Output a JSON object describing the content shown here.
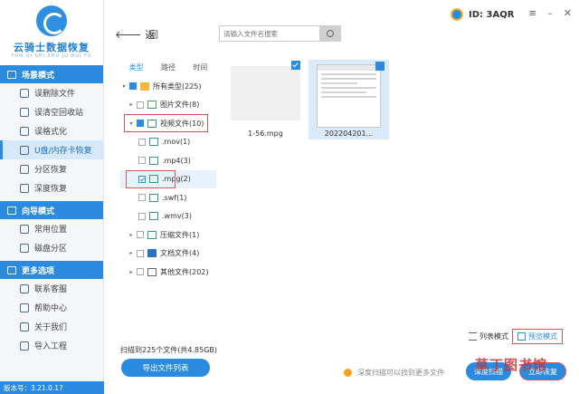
{
  "app": {
    "name": "云骑士数据恢复",
    "subtitle": "YUN QI SHI SHU JU HUI FU",
    "version": "版本号：3.21.0.17",
    "user_id": "ID: 3AQR"
  },
  "sidebar": {
    "sections": [
      {
        "title": "场景模式",
        "items": [
          "误删除文件",
          "误清空回收站",
          "误格式化",
          "U盘/内存卡恢复",
          "分区恢复",
          "深度恢复"
        ]
      },
      {
        "title": "向导模式",
        "items": [
          "常用位置",
          "磁盘分区"
        ]
      },
      {
        "title": "更多选项",
        "items": [
          "联系客服",
          "帮助中心",
          "关于我们",
          "导入工程"
        ]
      }
    ],
    "active_item": "U盘/内存卡恢复"
  },
  "toolbar": {
    "back_label": "返",
    "refresh_label": "回",
    "search_placeholder": "请输入文件名搜索"
  },
  "tree": {
    "tabs": [
      "类型",
      "路径",
      "时间"
    ],
    "rows": [
      {
        "label": "所有类型(225)"
      },
      {
        "label": "图片文件(8)"
      },
      {
        "label": "视频文件(10)"
      },
      {
        "label": ".mov(1)"
      },
      {
        "label": ".mp4(3)"
      },
      {
        "label": ".mpg(2)"
      },
      {
        "label": ".swf(1)"
      },
      {
        "label": ".wmv(3)"
      },
      {
        "label": "压缩文件(1)"
      },
      {
        "label": "文档文件(4)"
      },
      {
        "label": "其他文件(202)"
      }
    ]
  },
  "files": [
    {
      "name": "1-56.mpg"
    },
    {
      "name": "202204201..."
    }
  ],
  "view": {
    "list_label": "列表模式",
    "preview_label": "预览模式"
  },
  "footer": {
    "scan_info": "扫描到225个文件(共4.85GB)",
    "export_label": "导出文件列表",
    "hint": "深度扫描可以找到更多文件",
    "deep_scan_label": "深度扫描",
    "recover_label": "立即恢复",
    "watermark": "草丁图书馆"
  }
}
